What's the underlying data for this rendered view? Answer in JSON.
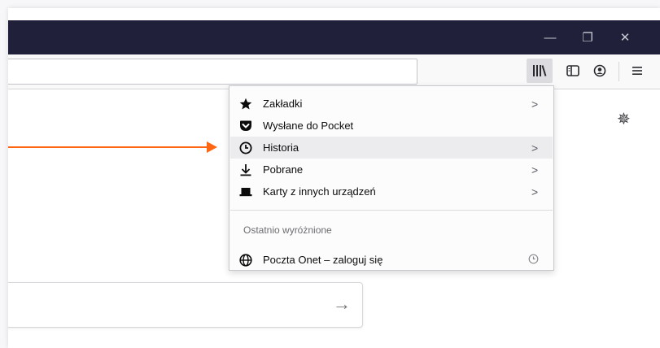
{
  "window": {
    "minimize_glyph": "—",
    "restore_glyph": "❐",
    "close_glyph": "✕"
  },
  "toolbar": {
    "url_value": "",
    "buttons": [
      "library-icon",
      "sidebar-icon",
      "account-icon",
      "hamburger-menu-icon"
    ]
  },
  "library_menu": {
    "items": [
      {
        "label": "Zakładki",
        "icon": "star-icon",
        "submenu": true
      },
      {
        "label": "Wysłane do Pocket",
        "icon": "pocket-icon",
        "submenu": false
      },
      {
        "label": "Historia",
        "icon": "clock-icon",
        "submenu": true,
        "highlighted": true
      },
      {
        "label": "Pobrane",
        "icon": "download-icon",
        "submenu": true
      },
      {
        "label": "Karty z innych urządzeń",
        "icon": "synced-tabs-icon",
        "submenu": true
      }
    ],
    "section_header": "Ostatnio wyróżnione",
    "recent": [
      {
        "label": "Poczta Onet – zaloguj się",
        "icon": "globe-icon",
        "meta_icon": "history-clock-icon"
      }
    ]
  },
  "search": {
    "value": "",
    "go_glyph": "→"
  },
  "settings_glyph": "✵",
  "colors": {
    "titlebar": "#20203a",
    "annotation_arrow": "#ff6611",
    "menu_highlight": "#ececee"
  }
}
